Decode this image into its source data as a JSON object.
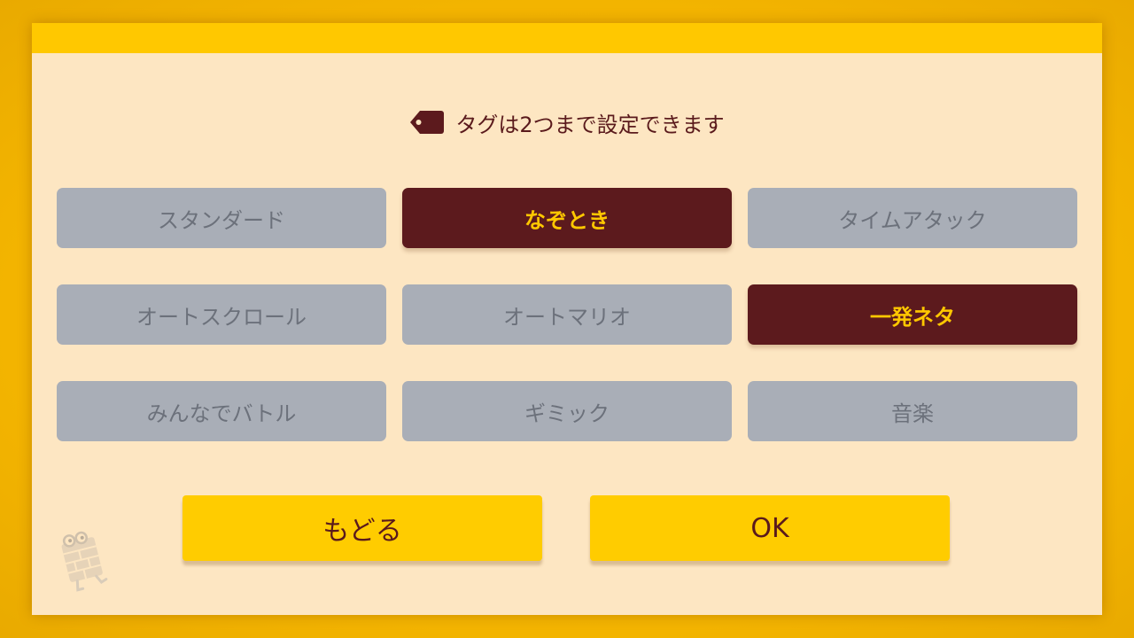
{
  "colors": {
    "background": "#f2b600",
    "panel": "#fde6c2",
    "header_bar": "#ffc800",
    "tag_unselected": "#a9aeb7",
    "tag_unselected_text": "#6c717b",
    "tag_selected": "#5c1a1d",
    "tag_selected_text": "#ffc800",
    "action_button": "#ffcc00",
    "text_dark": "#5a1a1c"
  },
  "notice": {
    "icon": "tag-icon",
    "text": "タグは2つまで設定できます"
  },
  "tags": [
    {
      "label": "スタンダード",
      "selected": false
    },
    {
      "label": "なぞとき",
      "selected": true
    },
    {
      "label": "タイムアタック",
      "selected": false
    },
    {
      "label": "オートスクロール",
      "selected": false
    },
    {
      "label": "オートマリオ",
      "selected": false
    },
    {
      "label": "一発ネタ",
      "selected": true
    },
    {
      "label": "みんなでバトル",
      "selected": false
    },
    {
      "label": "ギミック",
      "selected": false
    },
    {
      "label": "音楽",
      "selected": false
    }
  ],
  "actions": {
    "back_label": "もどる",
    "ok_label": "OK"
  },
  "mascot": {
    "icon": "brick-mascot-icon"
  }
}
